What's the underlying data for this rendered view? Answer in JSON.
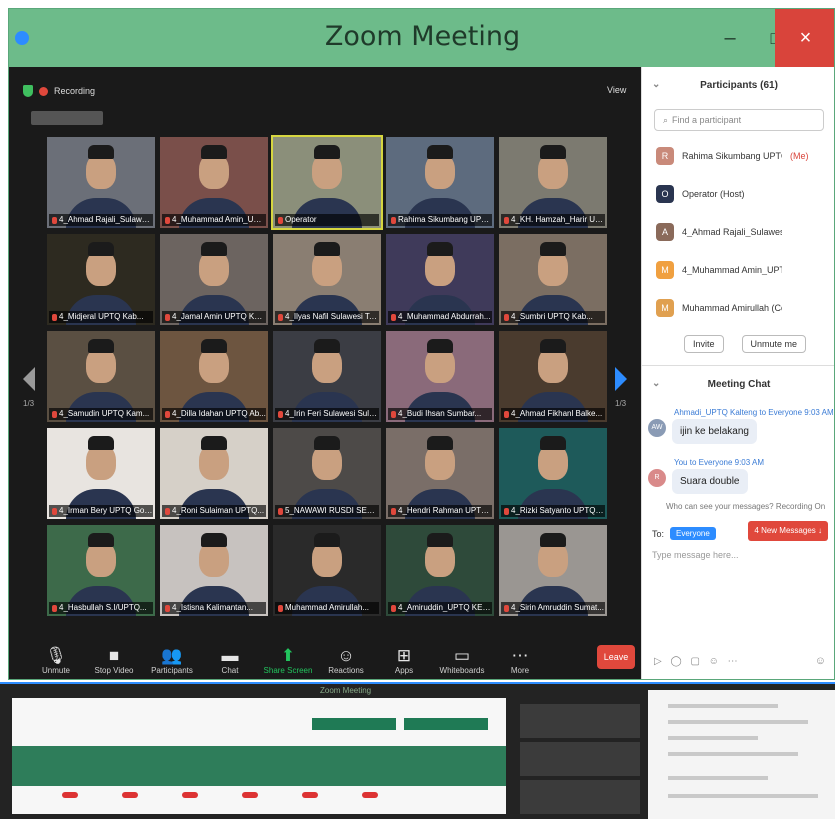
{
  "window": {
    "title": "Zoom Meeting",
    "minimize": "–",
    "maximize": "□",
    "close": "×"
  },
  "meeting": {
    "recording_label": "Recording",
    "view_label": "View",
    "page_left": "1/3",
    "page_right": "1/3"
  },
  "tiles": [
    "4_Ahmad Rajali_Sulawesi UP...",
    "4_Muhammad Amin_UPTQ K...",
    "Operator",
    "Rahima Sikumbang UPTQ...",
    "4_KH. Hamzah_Harir UPT...",
    "4_Midjeral UPTQ Kab...",
    "4_Jamal Amin UPTQ Kabu...",
    "4_Ilyas Nafil Sulawesi Tengg...",
    "4_Muhammad Abdurrah...",
    "4_Sumbri UPTQ Kab...",
    "4_Samudin UPTQ Kam...",
    "4_Dilla Idahan UPTQ Ab...",
    "4_Irin Feri Sulawesi Sula...",
    "4_Budi Ihsan Sumbar...",
    "4_Ahmad Fikhanl Balke...",
    "4_Irman Bery UPTQ Gor...",
    "4_Roni Sulaiman UPTQ...",
    "5_NAWAWI RUSDI SEP Ria...",
    "4_Hendri Rahman UPTQ...",
    "4_Rizki Satyanto UPTQ K...",
    "4_Hasbullah S.I/UPTQ...",
    "4_Istisna Kalimantan...",
    "Muhammad Amirullah...",
    "4_Amiruddin_UPTQ KEPR...",
    "4_Sirin Amruddin Sumat..."
  ],
  "toolbar": {
    "unmute": "Unmute",
    "stop_video": "Stop Video",
    "participants": "Participants",
    "participants_count": "61",
    "chat": "Chat",
    "share_screen": "Share Screen",
    "reactions": "Reactions",
    "apps": "Apps",
    "whiteboards": "Whiteboards",
    "more": "More",
    "leave": "Leave"
  },
  "participants_panel": {
    "title": "Participants (61)",
    "search_placeholder": "Find a participant",
    "items": [
      {
        "name": "Rahima Sikumbang UPTQ...",
        "status": "(Me)",
        "initial": "R"
      },
      {
        "name": "Operator (Host)",
        "status": "",
        "initial": "O"
      },
      {
        "name": "4_Ahmad Rajali_Sulawesi U...",
        "status": "",
        "initial": "A"
      },
      {
        "name": "4_Muhammad Amin_UPTQ L...",
        "status": "",
        "initial": "M"
      },
      {
        "name": "Muhammad Amirullah (Co-host)",
        "status": "",
        "initial": "M"
      }
    ],
    "invite": "Invite",
    "unmute_me": "Unmute me"
  },
  "chat_panel": {
    "title": "Meeting Chat",
    "messages": [
      {
        "meta": "Ahmadi_UPTQ Kalteng to Everyone 9:03 AM",
        "avatar": "AW",
        "text": "ijin ke belakang"
      },
      {
        "meta": "You to Everyone 9:03 AM",
        "avatar": "R",
        "text": "Suara double"
      }
    ],
    "new_messages": "4 New Messages ↓",
    "privacy_note": "Who can see your messages? Recording On",
    "to_label": "To:",
    "to_value": "Everyone",
    "input_placeholder": "Type message here...",
    "tools": "▷ ◯ ▢ ☺ ⋯",
    "emoji": "☺"
  },
  "bottom_screenshot": {
    "title": "Zoom Meeting"
  }
}
